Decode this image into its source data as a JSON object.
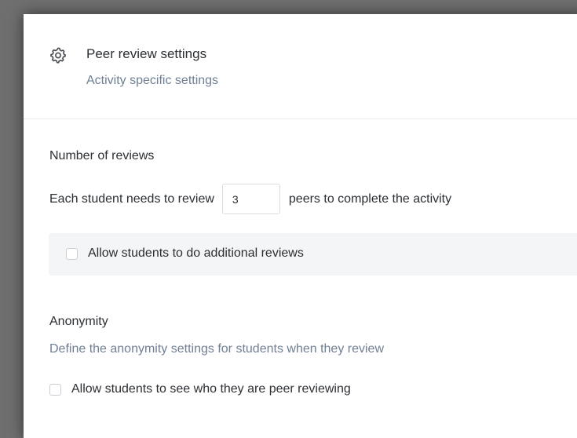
{
  "header": {
    "icon": "gear-icon",
    "title": "Peer review settings",
    "subtitle": "Activity specific settings"
  },
  "reviews": {
    "title": "Number of reviews",
    "sentence_before": "Each student needs to review",
    "count_value": "3",
    "sentence_after": "peers to complete the activity",
    "additional_reviews_label": "Allow students to do additional reviews",
    "additional_reviews_checked": false
  },
  "anonymity": {
    "title": "Anonymity",
    "description": "Define the anonymity settings for students when they review",
    "see_reviewees_label": "Allow students to see who they are peer reviewing",
    "see_reviewees_checked": false
  },
  "colors": {
    "panel_background": "#ffffff",
    "backdrop": "#6f6f6f",
    "text_primary": "#2b2f33",
    "text_secondary": "#6f7f94",
    "option_background": "#f4f5f6"
  }
}
